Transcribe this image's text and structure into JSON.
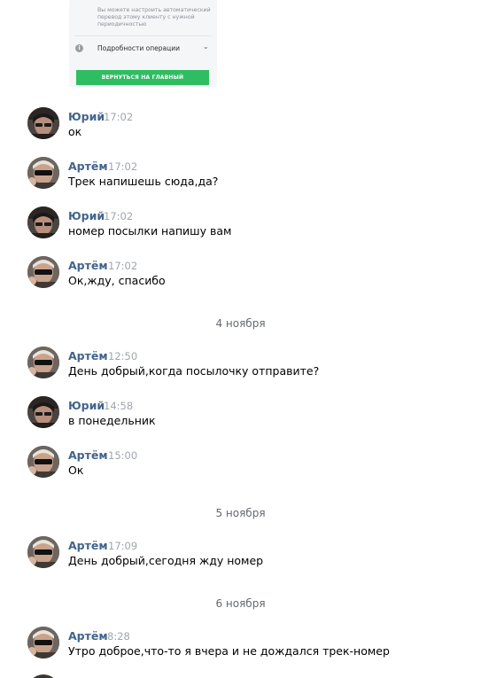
{
  "attachment": {
    "note": "Вы можете настроить автоматический перевод этому клиенту с нужной периодичностью",
    "details_label": "Подробности операции",
    "button_label": "ВЕРНУТЬСЯ НА ГЛАВНЫЙ",
    "button_color": "#2fbd61"
  },
  "colors": {
    "author": "#42648b",
    "time": "#a0a6ad",
    "date_separator": "#656a70"
  },
  "messages": [
    {
      "author": "Юрий",
      "time": "17:02",
      "text": "ок",
      "avatar": "yuri-avatar"
    },
    {
      "author": "Артём",
      "time": "17:02",
      "text": "Трек напишешь сюда,да?",
      "avatar": "artem-avatar"
    },
    {
      "author": "Юрий",
      "time": "17:02",
      "text": "номер посылки напишу вам",
      "avatar": "yuri-avatar"
    },
    {
      "author": "Артём",
      "time": "17:02",
      "text": "Ок,жду, спасибо",
      "avatar": "artem-avatar"
    },
    {
      "author": "Артём",
      "time": "12:50",
      "text": "День добрый,когда посылочку отправите?",
      "avatar": "artem-avatar"
    },
    {
      "author": "Юрий",
      "time": "14:58",
      "text": "в понедельник",
      "avatar": "yuri-avatar"
    },
    {
      "author": "Артём",
      "time": "15:00",
      "text": "Ок",
      "avatar": "artem-avatar"
    },
    {
      "author": "Артём",
      "time": "17:09",
      "text": "День добрый,сегодня жду номер",
      "avatar": "artem-avatar"
    },
    {
      "author": "Артём",
      "time": "8:28",
      "text": "Утро доброе,что-то я вчера и не дождался трек-номер",
      "avatar": "artem-avatar"
    }
  ],
  "date_separators": [
    "4 ноября",
    "5 ноября",
    "6 ноября"
  ]
}
